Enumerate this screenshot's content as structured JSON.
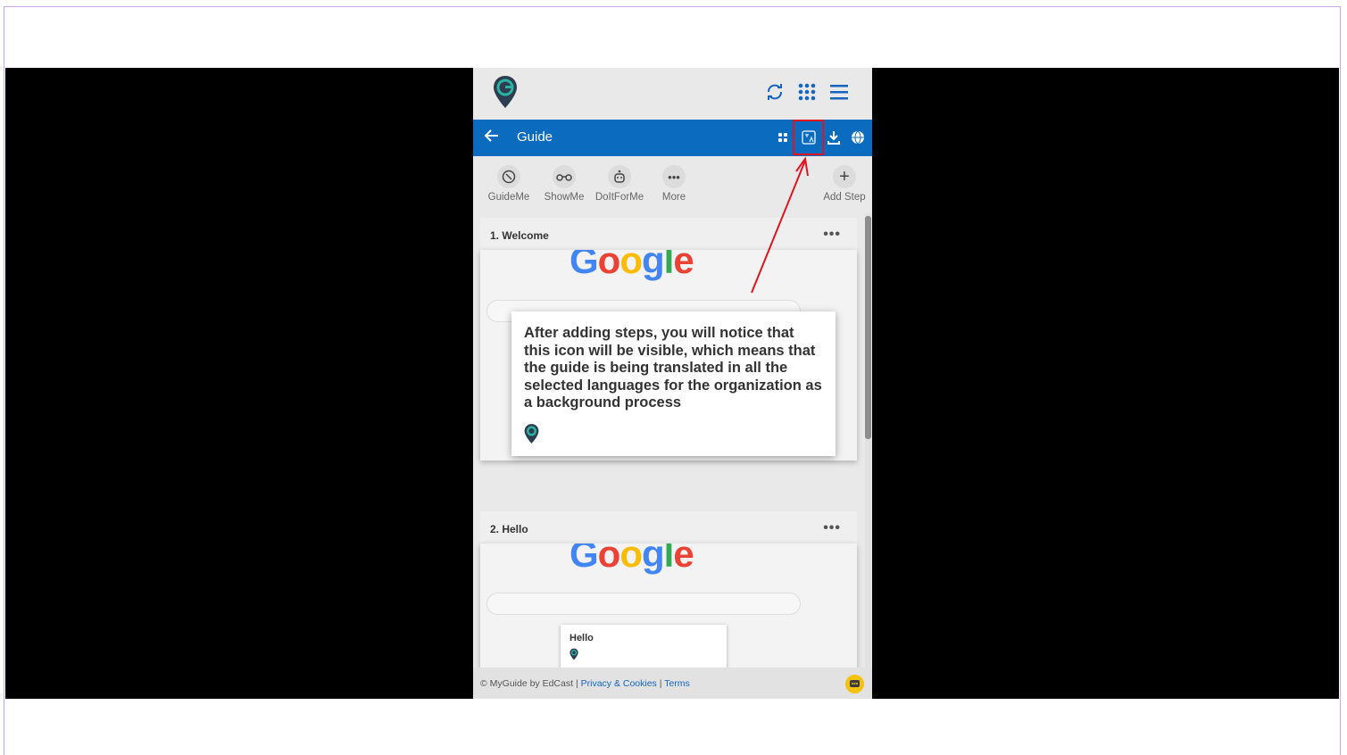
{
  "header": {
    "title": "Guide"
  },
  "toolbar": {
    "guideme": "GuideMe",
    "showme": "ShowMe",
    "doitforme": "DoItForMe",
    "more": "More",
    "add_step": "Add Step"
  },
  "steps": [
    {
      "title": "1. Welcome"
    },
    {
      "title": "2. Hello",
      "preview_tooltip": "Hello"
    }
  ],
  "preview": {
    "logo_text": "Google"
  },
  "popup": {
    "text": "After adding steps, you will notice that this icon will be visible, which means that the guide is being translated in all the selected languages for the organization as a background process"
  },
  "footer": {
    "copyright": "© MyGuide by EdCast",
    "sep1": "|",
    "privacy": "Privacy & Cookies",
    "sep2": "|",
    "terms": "Terms"
  },
  "colors": {
    "accent": "#0b6cbf",
    "highlight": "#e0141e",
    "brand_pin": "#2c3e50"
  },
  "icons": [
    "refresh-icon",
    "apps-grid-icon",
    "hamburger-menu-icon",
    "back-arrow-icon",
    "grid-icon",
    "translation-icon",
    "download-icon",
    "globe-icon",
    "chat-icon"
  ]
}
